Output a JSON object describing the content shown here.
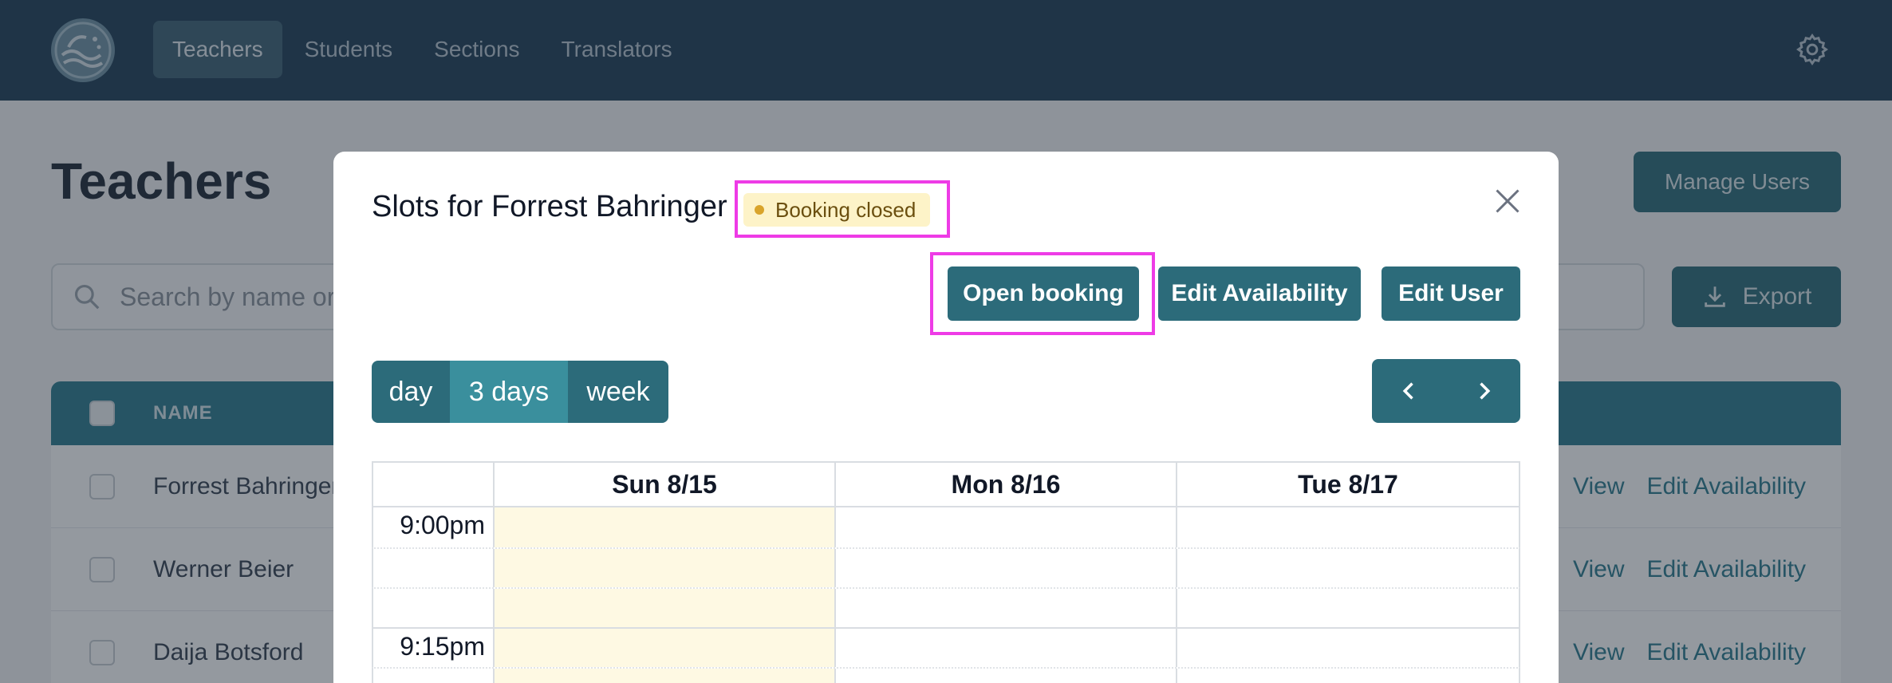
{
  "nav": {
    "items": [
      {
        "label": "Teachers",
        "active": true
      },
      {
        "label": "Students",
        "active": false
      },
      {
        "label": "Sections",
        "active": false
      },
      {
        "label": "Translators",
        "active": false
      }
    ]
  },
  "page": {
    "title": "Teachers",
    "manage_users_label": "Manage Users",
    "search_placeholder": "Search by name or email",
    "export_label": "Export",
    "table": {
      "name_header": "NAME",
      "rows": [
        {
          "name": "Forrest Bahringer",
          "view": "View",
          "edit": "Edit Availability"
        },
        {
          "name": "Werner Beier",
          "view": "View",
          "edit": "Edit Availability"
        },
        {
          "name": "Daija Botsford",
          "view": "View",
          "edit": "Edit Availability"
        }
      ]
    }
  },
  "modal": {
    "title": "Slots for Forrest Bahringer",
    "badge": "Booking closed",
    "buttons": {
      "open_booking": "Open booking",
      "edit_availability": "Edit Availability",
      "edit_user": "Edit User"
    },
    "view_options": [
      "day",
      "3 days",
      "week"
    ],
    "selected_view": "3 days",
    "calendar": {
      "days": [
        "Sun 8/15",
        "Mon 8/16",
        "Tue 8/17"
      ],
      "today_index": 0,
      "time_labels": [
        "9:00pm",
        "9:15pm"
      ]
    }
  },
  "colors": {
    "nav_bg": "#1f3f57",
    "primary": "#2c6b7a",
    "highlight": "#ee3be6",
    "badge_bg": "#fdf3c8",
    "today_bg": "#fef9e3"
  }
}
